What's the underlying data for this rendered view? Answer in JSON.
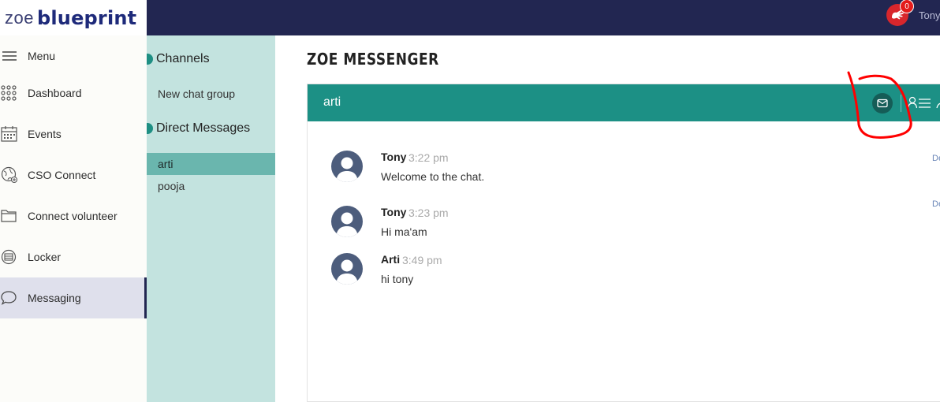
{
  "brand": {
    "light": "zoe",
    "bold": "blueprint"
  },
  "topbar": {
    "notification_count": "0",
    "username": "Tony"
  },
  "sidebar": {
    "items": [
      {
        "label": "Menu",
        "icon": "hamburger-icon"
      },
      {
        "label": "Dashboard",
        "icon": "grid-dots-icon"
      },
      {
        "label": "Events",
        "icon": "calendar-icon"
      },
      {
        "label": "CSO Connect",
        "icon": "globe-icon"
      },
      {
        "label": "Connect volunteer",
        "icon": "folder-icon"
      },
      {
        "label": "Locker",
        "icon": "locker-icon"
      },
      {
        "label": "Messaging",
        "icon": "chat-bubble-icon"
      }
    ],
    "active": "Messaging"
  },
  "channels": {
    "channels_heading": "Channels",
    "new_group": "New chat group",
    "dm_heading": "Direct Messages",
    "dms": [
      "arti",
      "pooja"
    ],
    "active_dm": "arti"
  },
  "main": {
    "title": "ZOE MESSENGER",
    "chat": {
      "name": "arti",
      "messages": [
        {
          "sender": "Tony",
          "time": "3:22 pm",
          "text": "Welcome to the chat.",
          "action": "De"
        },
        {
          "sender": "Tony",
          "time": "3:23 pm",
          "text": "Hi ma'am",
          "action": "De"
        },
        {
          "sender": "Arti",
          "time": "3:49 pm",
          "text": "hi tony"
        }
      ]
    }
  },
  "colors": {
    "topbar": "#222651",
    "chat_header": "#1c9085",
    "channels_bg": "#c3e3df",
    "active_dm": "#6ab6ae",
    "annotation": "#ff0000"
  }
}
